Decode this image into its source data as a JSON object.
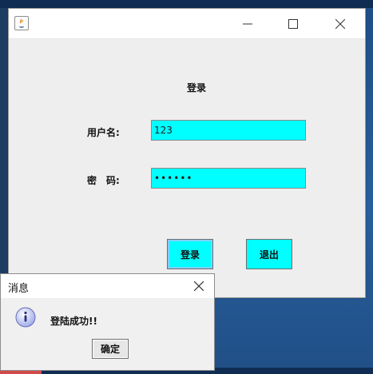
{
  "main_window": {
    "title": "",
    "heading": "登录",
    "username_label": "用户名:",
    "username_value": "123",
    "password_label": "密　码:",
    "password_masked": "••••••",
    "login_button": "登录",
    "exit_button": "退出",
    "colors": {
      "field_bg": "#00ffff",
      "window_bg": "#eeeeee"
    },
    "icons": [
      "java-icon",
      "minimize-icon",
      "maximize-icon",
      "close-icon"
    ]
  },
  "dialog": {
    "title": "消息",
    "message": "登陆成功!!",
    "ok_button": "确定",
    "icons": [
      "info-icon",
      "close-icon"
    ]
  }
}
